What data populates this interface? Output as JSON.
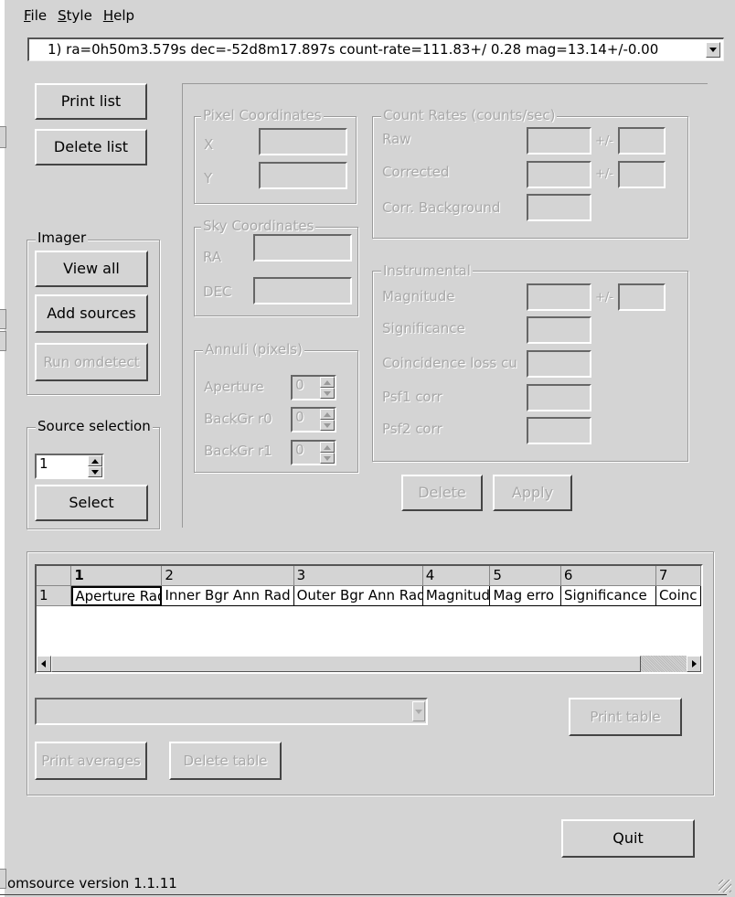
{
  "menu": {
    "file": "File",
    "file_u": "F",
    "style": "Style",
    "style_u": "S",
    "help": "Help",
    "help_u": "H"
  },
  "source_combo": {
    "value": "1) ra=0h50m3.579s dec=-52d8m17.897s count-rate=111.83+/ 0.28 mag=13.14+/-0.00"
  },
  "list_buttons": {
    "print_list": "Print list",
    "delete_list": "Delete list"
  },
  "imager": {
    "label": "Imager",
    "view_all": "View all",
    "add_sources": "Add sources",
    "run_omdetect": "Run omdetect"
  },
  "source_selection": {
    "label": "Source selection",
    "value": "1",
    "select": "Select"
  },
  "pixel_coords": {
    "label": "Pixel Coordinates",
    "x": "X",
    "y": "Y"
  },
  "sky_coords": {
    "label": "Sky Coordinates",
    "ra": "RA",
    "dec": "DEC"
  },
  "annuli": {
    "label": "Annuli (pixels)",
    "aperture": "Aperture",
    "bgr_r0": "BackGr r0",
    "bgr_r1": "BackGr r1",
    "aperture_val": "0",
    "bgr_r0_val": "0",
    "bgr_r1_val": "0"
  },
  "count_rates": {
    "label": "Count Rates (counts/sec)",
    "raw": "Raw",
    "corrected": "Corrected",
    "corr_bg": "Corr. Background",
    "pm": "+/-"
  },
  "instrumental": {
    "label": "Instrumental",
    "magnitude": "Magnitude",
    "significance": "Significance",
    "coincidence": "Coincidence loss cu",
    "psf1": "Psf1 corr",
    "psf2": "Psf2 corr",
    "pm": "+/-"
  },
  "edit_buttons": {
    "delete": "Delete",
    "apply": "Apply"
  },
  "table": {
    "headers": [
      "1",
      "2",
      "3",
      "4",
      "5",
      "6",
      "7"
    ],
    "row_label": "1",
    "row": [
      "Aperture Rad",
      "Inner Bgr Ann Rad",
      "Outer Bgr Ann Rad",
      "Magnitud",
      "Mag erro",
      "Significance",
      "Coinc"
    ]
  },
  "table_controls": {
    "print_table": "Print table",
    "print_averages": "Print averages",
    "delete_table": "Delete table"
  },
  "quit": "Quit",
  "status": "omsource version 1.1.11"
}
